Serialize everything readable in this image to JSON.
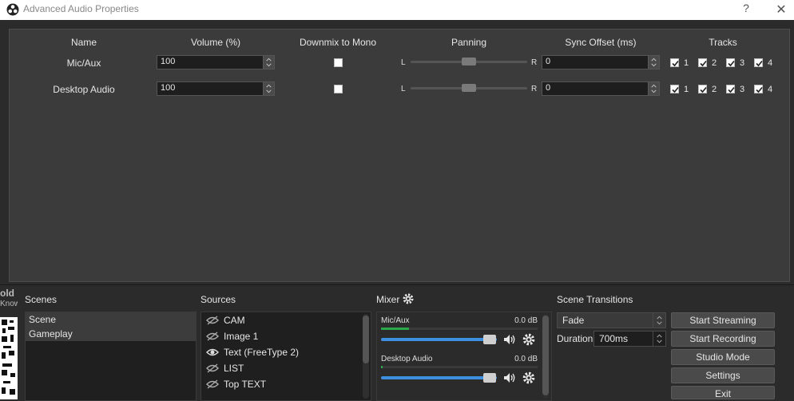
{
  "dialog": {
    "title": "Advanced Audio Properties",
    "help": "?",
    "close": "✕",
    "columns": {
      "name": "Name",
      "volume": "Volume (%)",
      "downmix": "Downmix to Mono",
      "panning": "Panning",
      "sync": "Sync Offset (ms)",
      "tracks": "Tracks"
    },
    "pan_left": "L",
    "pan_right": "R",
    "rows": [
      {
        "name": "Mic/Aux",
        "volume": "100",
        "downmix": false,
        "pan": 0.5,
        "sync": "0",
        "tracks": [
          {
            "label": "1",
            "checked": true
          },
          {
            "label": "2",
            "checked": true
          },
          {
            "label": "3",
            "checked": true
          },
          {
            "label": "4",
            "checked": true
          }
        ]
      },
      {
        "name": "Desktop Audio",
        "volume": "100",
        "downmix": false,
        "pan": 0.5,
        "sync": "0",
        "tracks": [
          {
            "label": "1",
            "checked": true
          },
          {
            "label": "2",
            "checked": true
          },
          {
            "label": "3",
            "checked": true
          },
          {
            "label": "4",
            "checked": true
          }
        ]
      }
    ]
  },
  "obs": {
    "left_text_1": "old",
    "left_text_2": "Know",
    "scenes": {
      "title": "Scenes",
      "items": [
        "Scene",
        "Gameplay"
      ]
    },
    "sources": {
      "title": "Sources",
      "items": [
        {
          "label": "CAM",
          "visible": false
        },
        {
          "label": "Image 1",
          "visible": false
        },
        {
          "label": "Text (FreeType 2)",
          "visible": true
        },
        {
          "label": "LIST",
          "visible": false
        },
        {
          "label": "Top TEXT",
          "visible": false
        }
      ]
    },
    "mixer": {
      "title": "Mixer",
      "tracks": [
        {
          "name": "Mic/Aux",
          "db": "0.0 dB"
        },
        {
          "name": "Desktop Audio",
          "db": "0.0 dB"
        }
      ]
    },
    "transitions": {
      "title": "Scene Transitions",
      "selected": "Fade",
      "duration_label": "Duration",
      "duration_value": "700ms"
    },
    "controls": [
      "Start Streaming",
      "Start Recording",
      "Studio Mode",
      "Settings",
      "Exit"
    ]
  }
}
